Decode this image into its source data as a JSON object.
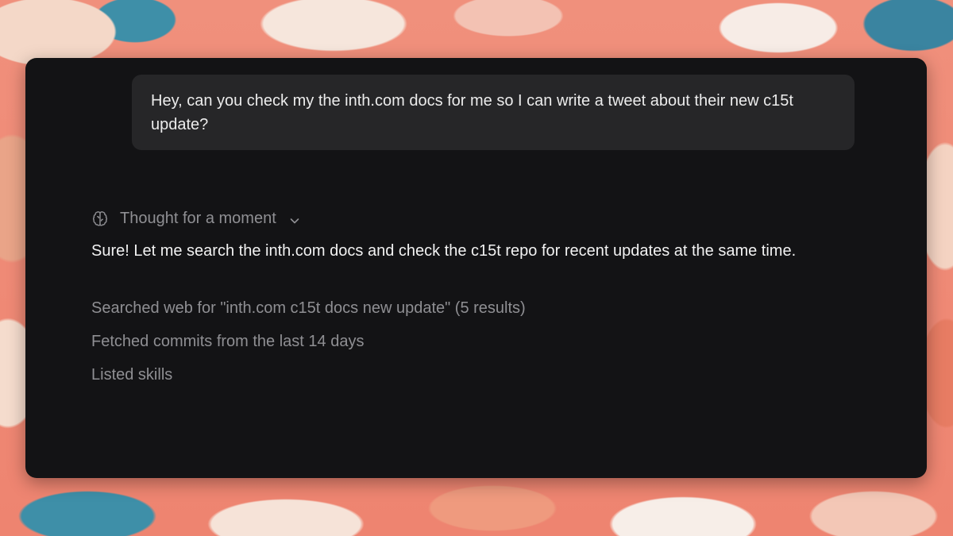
{
  "conversation": {
    "user_message": "Hey, can you check my the inth.com docs for me so I can write a tweet about their new c15t update?",
    "thought": {
      "label": "Thought for a moment",
      "icon": "brain-icon",
      "toggle_icon": "chevron-down-icon"
    },
    "assistant_message": "Sure! Let me search the inth.com docs and check the c15t repo for recent updates at the same time.",
    "steps": [
      {
        "label": "Searched web for \"inth.com c15t docs new update\" (5 results)"
      },
      {
        "label": "Fetched commits from the last 14 days"
      },
      {
        "label": "Listed skills"
      }
    ]
  },
  "colors": {
    "panel_bg": "#131315",
    "bubble_bg": "#262628",
    "primary_text": "#f2f2f2",
    "muted_text": "#8f8f93",
    "wallpaper_accent": "#f08a78"
  }
}
